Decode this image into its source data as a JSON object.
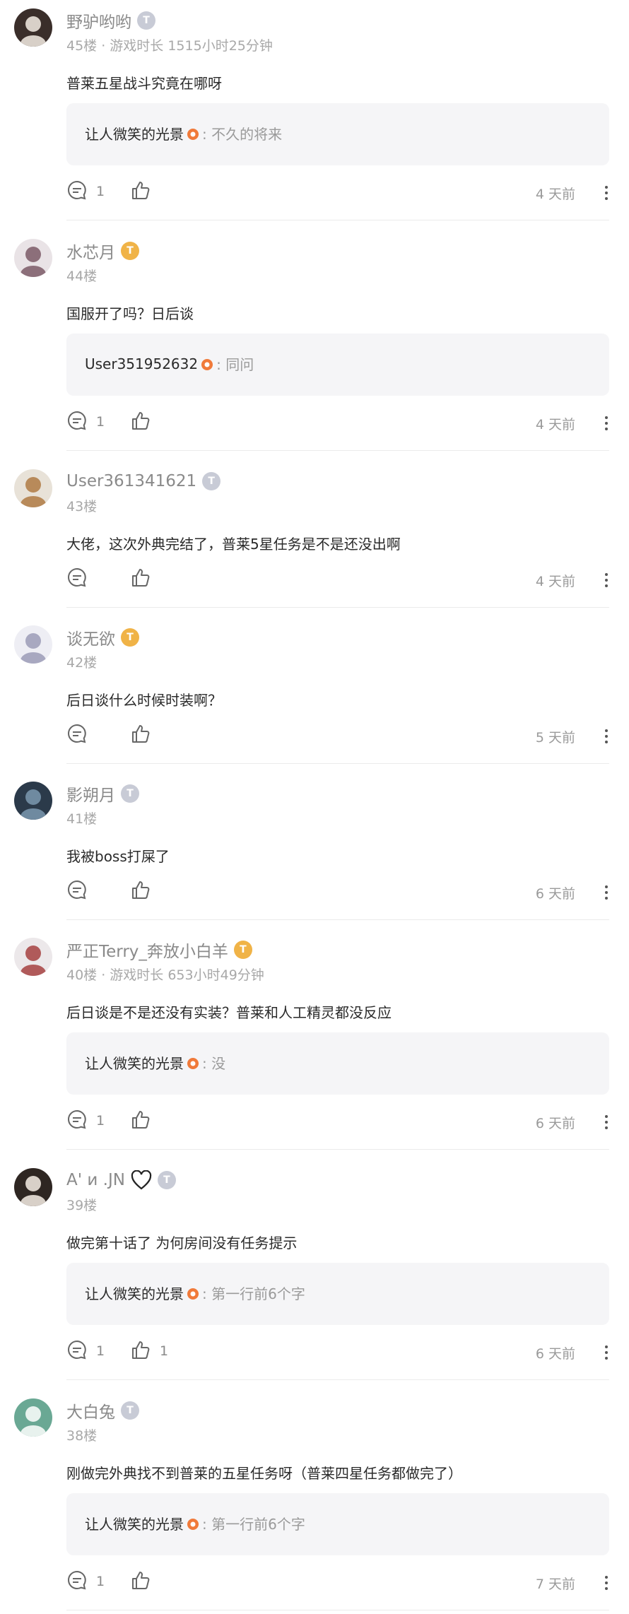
{
  "comments": [
    {
      "user": "野驴哟哟",
      "badge": "T",
      "badge_color": "gray",
      "meta": "45楼 · 游戏时长 1515小时25分钟",
      "content": "普莱五星战斗究竟在哪呀",
      "reply": {
        "author": "让人微笑的光景",
        "text": ": 不久的将来"
      },
      "comment_count": "1",
      "like_count": "",
      "time": "4 天前"
    },
    {
      "user": "水芯月",
      "badge": "T",
      "badge_color": "gold",
      "meta": "44楼",
      "content": "国服开了吗？日后谈",
      "reply": {
        "author": "User351952632",
        "text": ": 同问"
      },
      "comment_count": "1",
      "like_count": "",
      "time": "4 天前"
    },
    {
      "user": "User361341621",
      "badge": "T",
      "badge_color": "gray",
      "meta": "43楼",
      "content": "大佬，这次外典完结了，普莱5星任务是不是还没出啊",
      "reply": null,
      "comment_count": "",
      "like_count": "",
      "time": "4 天前"
    },
    {
      "user": "谈无欲",
      "badge": "T",
      "badge_color": "gold",
      "meta": "42楼",
      "content": "后日谈什么时候时装啊？",
      "reply": null,
      "comment_count": "",
      "like_count": "",
      "time": "5 天前"
    },
    {
      "user": "影朔月",
      "badge": "T",
      "badge_color": "gray",
      "meta": "41楼",
      "content": "我被boss打屎了",
      "reply": null,
      "comment_count": "",
      "like_count": "",
      "time": "6 天前"
    },
    {
      "user": "严正Terry_奔放小白羊",
      "badge": "T",
      "badge_color": "gold",
      "meta": "40楼 · 游戏时长 653小时49分钟",
      "content": "后日谈是不是还没有实装？普莱和人工精灵都没反应",
      "reply": {
        "author": "让人微笑的光景",
        "text": ": 没"
      },
      "comment_count": "1",
      "like_count": "",
      "time": "6 天前"
    },
    {
      "user": "A' и .JN",
      "badge": "T",
      "badge_color": "gray",
      "heart": true,
      "meta": "39楼",
      "content": "做完第十话了 为何房间没有任务提示",
      "reply": {
        "author": "让人微笑的光景",
        "text": ": 第一行前6个字"
      },
      "comment_count": "1",
      "like_count": "1",
      "time": "6 天前"
    },
    {
      "user": "大白兔",
      "badge": "T",
      "badge_color": "gray",
      "meta": "38楼",
      "content": "刚做完外典找不到普莱的五星任务呀（普莱四星任务都做完了）",
      "reply": {
        "author": "让人微笑的光景",
        "text": ": 第一行前6个字"
      },
      "comment_count": "1",
      "like_count": "",
      "time": "7 天前"
    }
  ],
  "icons": {
    "comment": "comment-bubble-icon",
    "like": "thumbs-up-icon",
    "more": "more-vertical-icon",
    "badge": "level-badge-icon",
    "author_mark": "author-flower-icon"
  },
  "colors": {
    "badge_gray": "#c8cbd6",
    "badge_gold": "#f0b347",
    "reply_bg": "#f5f5f7",
    "author_mark": "#f07a3a"
  }
}
